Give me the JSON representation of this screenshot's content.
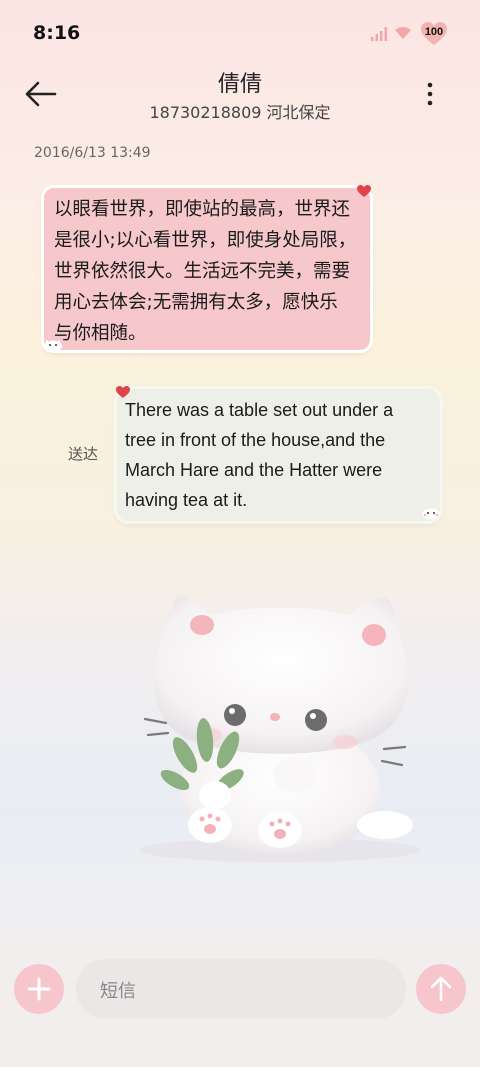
{
  "status_bar": {
    "time": "8:16",
    "battery": "100"
  },
  "header": {
    "contact_name": "倩倩",
    "contact_detail": "18730218809 河北保定"
  },
  "thread": {
    "date": "2016/6/13 13:49",
    "messages": [
      {
        "direction": "incoming",
        "lines": [
          "以眼看世界，即使站的最高，世界还",
          "是很小;以心看世界，即使身处局限，",
          "世界依然很大。生活远不完美，需要",
          "用心去体会;无需拥有太多，愿快乐",
          "与你相随。"
        ]
      },
      {
        "direction": "outgoing",
        "status": "送达",
        "lines": [
          "There was a table set out under a",
          "tree in front of the house,and the",
          "March Hare and the Hatter were",
          "having tea at it."
        ]
      }
    ]
  },
  "composer": {
    "placeholder": "短信"
  },
  "icons": {
    "back": "arrow-left-icon",
    "menu": "more-vertical-icon",
    "add": "plus-icon",
    "send": "arrow-up-icon"
  },
  "colors": {
    "incoming_bubble": "#f6c8cc",
    "outgoing_bubble": "#eef0e7",
    "action_button": "#f7c5cc"
  }
}
